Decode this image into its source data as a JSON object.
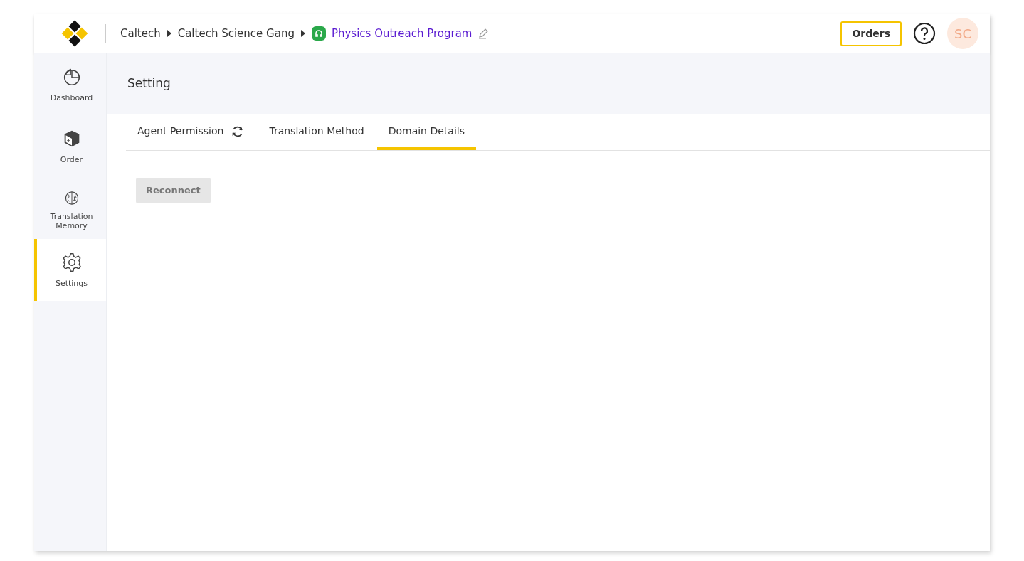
{
  "breadcrumb": [
    {
      "label": "Caltech",
      "kind": "link"
    },
    {
      "label": "Caltech Science Gang",
      "kind": "link"
    },
    {
      "label": "Physics Outreach Program",
      "kind": "current"
    }
  ],
  "header": {
    "orders_button": "Orders",
    "avatar": "SC"
  },
  "sidebar": {
    "items": [
      {
        "label": "Dashboard",
        "kind": "pie",
        "selected": false
      },
      {
        "label": "Order",
        "kind": "box",
        "selected": false
      },
      {
        "label": "Translation Memory",
        "kind": "brain",
        "selected": false
      },
      {
        "label": "Settings",
        "kind": "gear",
        "selected": true
      }
    ]
  },
  "page_title": "Setting",
  "tabs": [
    {
      "label": "Agent Permission",
      "refresh": true,
      "selected": false
    },
    {
      "label": "Translation Method",
      "refresh": false,
      "selected": false
    },
    {
      "label": "Domain Details",
      "refresh": false,
      "selected": true
    }
  ],
  "reconnect_button": {
    "label": "Reconnect",
    "disabled": true
  }
}
